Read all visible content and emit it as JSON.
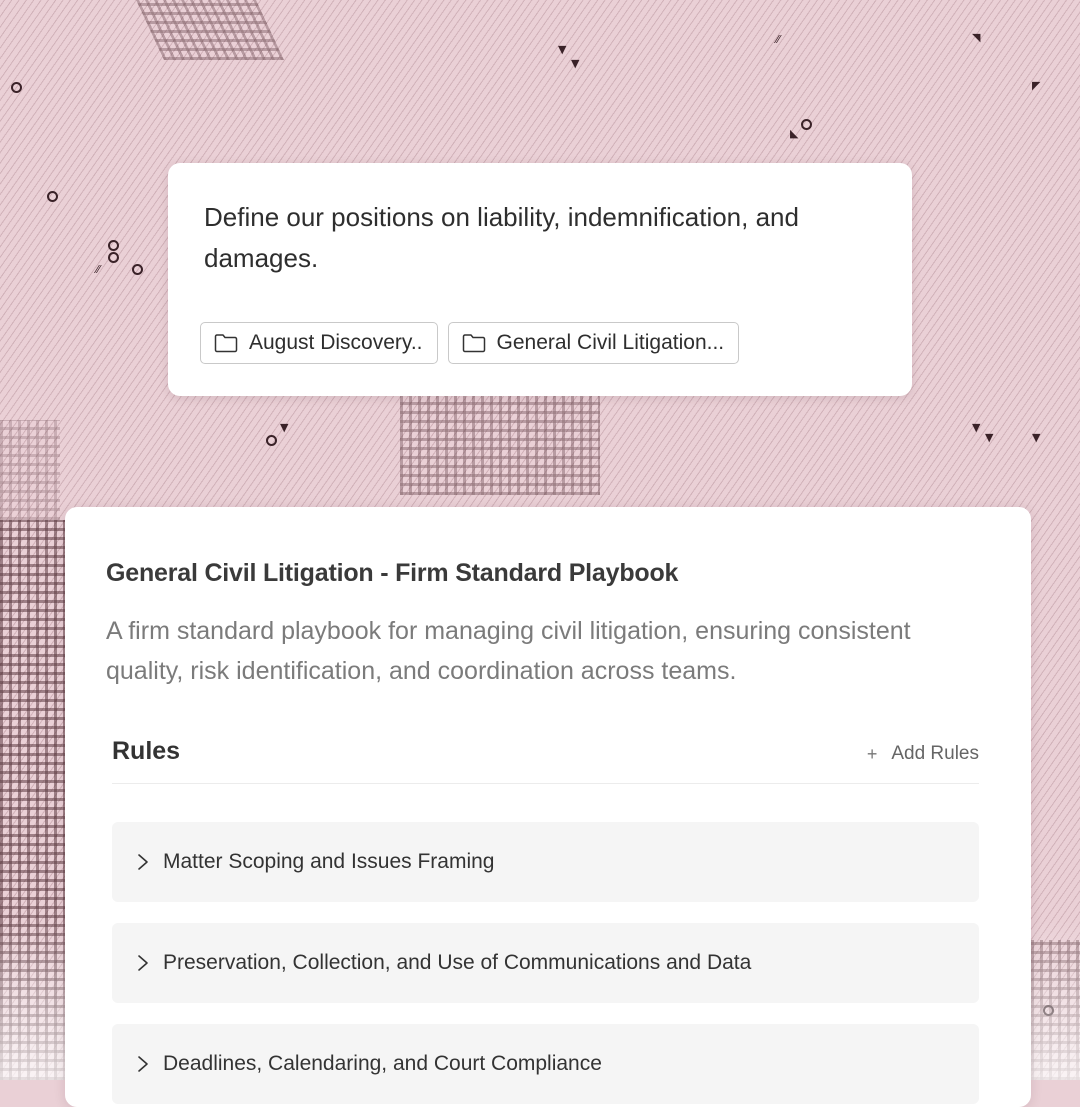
{
  "prompt": {
    "text": "Define our positions on liability, indemnification, and damages.",
    "attachments": [
      {
        "icon": "folder-icon",
        "label": "August Discovery.."
      },
      {
        "icon": "folder-icon",
        "label": "General Civil Litigation..."
      }
    ]
  },
  "playbook": {
    "title": "General Civil Litigation - Firm Standard Playbook",
    "description": "A firm standard playbook for managing civil litigation, ensuring consistent quality, risk identification, and coordination across teams.",
    "rules_heading": "Rules",
    "add_rules_label": "Add Rules",
    "rules": [
      {
        "label": "Matter Scoping and Issues Framing",
        "icon": "chevron-right-icon"
      },
      {
        "label": "Preservation, Collection, and Use of Communications and Data",
        "icon": "chevron-right-icon"
      },
      {
        "label": "Deadlines, Calendaring, and Court Compliance",
        "icon": "chevron-right-icon"
      }
    ]
  },
  "colors": {
    "background": "#ead0d6",
    "card": "#ffffff",
    "rule_item": "#f5f5f5",
    "text_primary": "#2e2e2e",
    "text_muted": "#7b7b7b"
  }
}
